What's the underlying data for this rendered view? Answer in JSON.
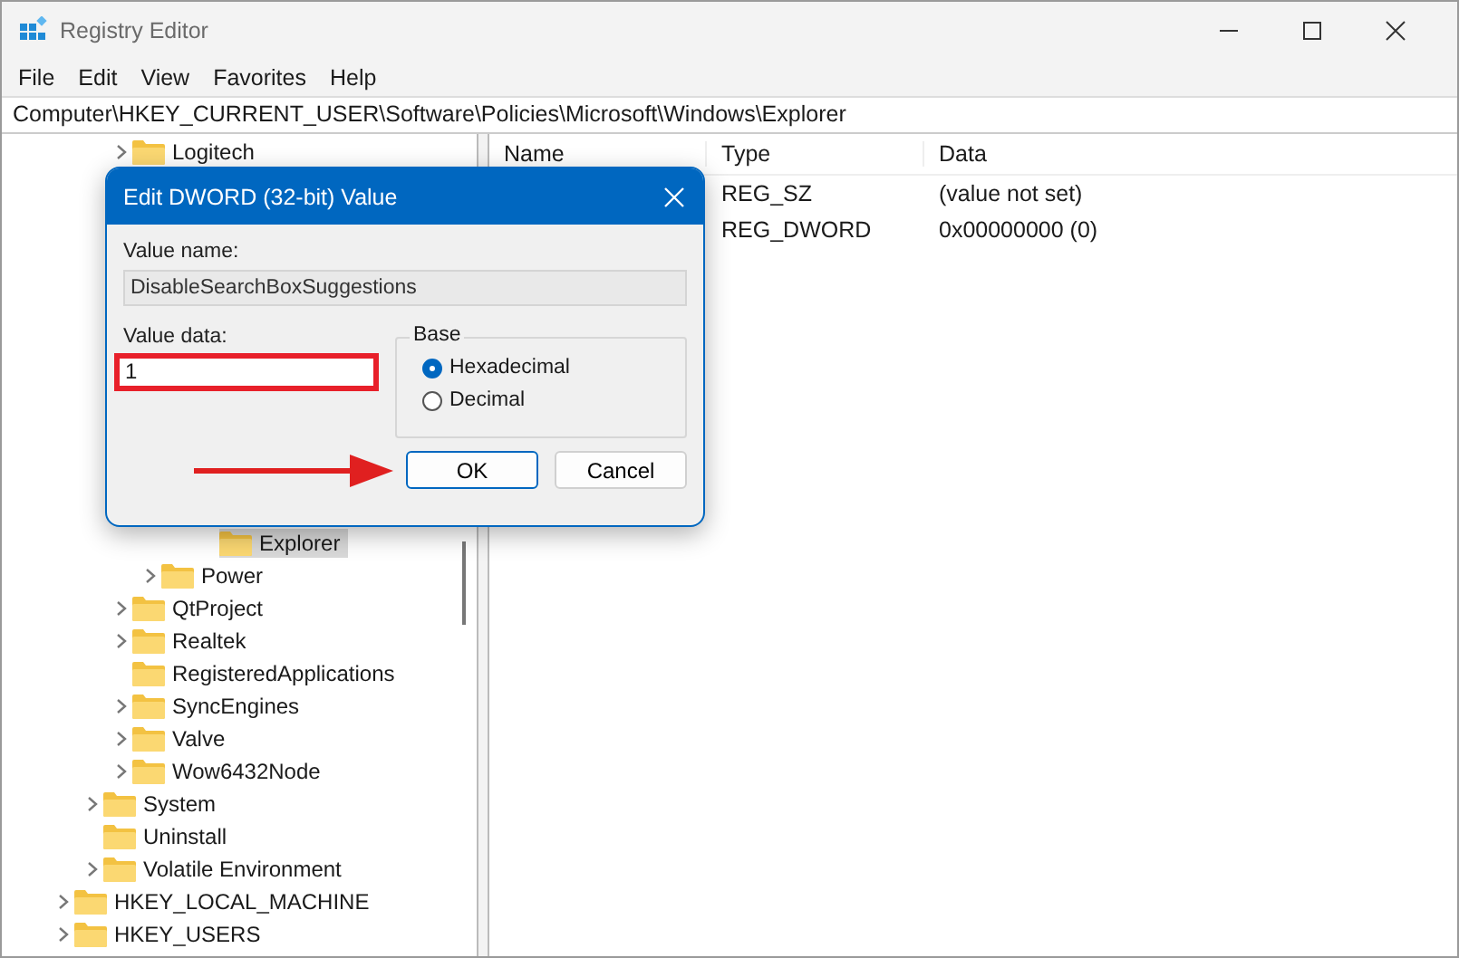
{
  "window": {
    "title": "Registry Editor"
  },
  "menu": [
    "File",
    "Edit",
    "View",
    "Favorites",
    "Help"
  ],
  "address": "Computer\\HKEY_CURRENT_USER\\Software\\Policies\\Microsoft\\Windows\\Explorer",
  "tree": [
    {
      "children": [
        {
          "children": [
            {
              "children": [
                {
                  "label": "Logitech",
                  "has_children": true,
                  "selected": false
                },
                {
                  "children": [
                    {
                      "children": [
                        {
                          "children": [
                            {
                              "label": "Explorer",
                              "has_children": false,
                              "selected": true
                            }
                          ]
                        }
                      ]
                    },
                    {
                      "label": "Power",
                      "has_children": true,
                      "selected": false
                    }
                  ]
                },
                {
                  "label": "QtProject",
                  "has_children": true,
                  "selected": false
                },
                {
                  "label": "Realtek",
                  "has_children": true,
                  "selected": false
                },
                {
                  "label": "RegisteredApplications",
                  "has_children": false,
                  "selected": false
                },
                {
                  "label": "SyncEngines",
                  "has_children": true,
                  "selected": false
                },
                {
                  "label": "Valve",
                  "has_children": true,
                  "selected": false
                },
                {
                  "label": "Wow6432Node",
                  "has_children": true,
                  "selected": false
                }
              ]
            },
            {
              "label": "System",
              "has_children": true,
              "selected": false
            },
            {
              "label": "Uninstall",
              "has_children": false,
              "selected": false
            },
            {
              "label": "Volatile Environment",
              "has_children": true,
              "selected": false
            }
          ]
        },
        {
          "label": "HKEY_LOCAL_MACHINE",
          "has_children": true,
          "selected": false
        },
        {
          "label": "HKEY_USERS",
          "has_children": true,
          "selected": false
        }
      ]
    }
  ],
  "list": {
    "columns": [
      "Name",
      "Type",
      "Data"
    ],
    "rows": [
      {
        "type": "REG_SZ",
        "data": "(value not set)"
      },
      {
        "type": "REG_DWORD",
        "data": "0x00000000 (0)"
      }
    ]
  },
  "dialog": {
    "title": "Edit DWORD (32-bit) Value",
    "value_name_label": "Value name:",
    "value_name": "DisableSearchBoxSuggestions",
    "value_data_label": "Value data:",
    "value_data": "1",
    "base_label": "Base",
    "bases": [
      {
        "label": "Hexadecimal",
        "selected": true
      },
      {
        "label": "Decimal",
        "selected": false
      }
    ],
    "buttons": [
      {
        "label": "OK",
        "default": true
      },
      {
        "label": "Cancel",
        "default": false
      }
    ]
  }
}
